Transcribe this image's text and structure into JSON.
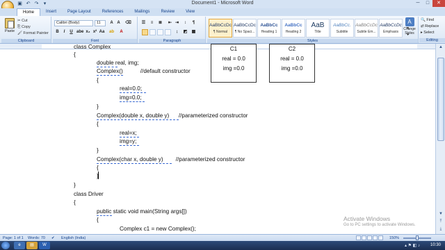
{
  "window": {
    "title": "Document1 - Microsoft Word"
  },
  "colors": {
    "accent": "#15428b",
    "ribbon_bg": "#dbe7f5",
    "close": "#c9463d",
    "squiggle": "#3a6ad3"
  },
  "tabs": [
    "Home",
    "Insert",
    "Page Layout",
    "References",
    "Mailings",
    "Review",
    "View"
  ],
  "clipboard": {
    "paste": "Paste",
    "cut": "Cut",
    "copy": "Copy",
    "format_painter": "Format Painter",
    "label": "Clipboard"
  },
  "font": {
    "name": "Calibri (Body)",
    "size": "11",
    "label": "Font"
  },
  "paragraph": {
    "label": "Paragraph"
  },
  "styles": {
    "label": "Styles",
    "items": [
      {
        "sample": "AaBbCcDc",
        "name": "¶ Normal"
      },
      {
        "sample": "AaBbCcDc",
        "name": "¶ No Spaci..."
      },
      {
        "sample": "AaBbCc",
        "name": "Heading 1"
      },
      {
        "sample": "AaBbCc",
        "name": "Heading 2"
      },
      {
        "sample": "AaB",
        "name": "Title"
      },
      {
        "sample": "AaBbCc.",
        "name": "Subtitle"
      },
      {
        "sample": "AaBbCcDc",
        "name": "Subtle Em..."
      },
      {
        "sample": "AaBbCcDc",
        "name": "Emphasis"
      }
    ],
    "change_styles": "Change Styles"
  },
  "editing": {
    "find": "Find",
    "replace": "Replace",
    "select": "Select",
    "label": "Editing"
  },
  "document": {
    "lines": [
      {
        "text": "class Complex",
        "indent": 0
      },
      {
        "text": "{",
        "indent": 0
      },
      {
        "text": "double real, img;",
        "indent": 1
      },
      {
        "text": "Complex()           //default constructor",
        "indent": 1
      },
      {
        "text": "{",
        "indent": 1
      },
      {
        "text": "real=0.0;",
        "indent": 2
      },
      {
        "text": "img=0.0;",
        "indent": 2
      },
      {
        "text": "}",
        "indent": 1
      },
      {
        "text": "Complex(double x, double y)      //parameterized constructor",
        "indent": 1
      },
      {
        "text": "{",
        "indent": 1
      },
      {
        "text": "real=x;",
        "indent": 2
      },
      {
        "text": "img=y;",
        "indent": 2
      },
      {
        "text": "}",
        "indent": 1
      },
      {
        "text": "Complex(char x, double y)        //parameterized constructor",
        "indent": 1
      },
      {
        "text": "{",
        "indent": 1
      },
      {
        "text": "}",
        "indent": 1
      },
      {
        "text": "}",
        "indent": 0
      },
      {
        "text": "class Driver",
        "indent": 0
      },
      {
        "text": "{",
        "indent": 0
      },
      {
        "text": "public static void main(String args[])",
        "indent": 1
      },
      {
        "text": "{",
        "indent": 1
      },
      {
        "text": "Complex c1 = new Complex();",
        "indent": 2
      }
    ],
    "boxes": [
      {
        "title": "C1",
        "real": "real = 0.0",
        "img": "img =0.0"
      },
      {
        "title": "C2",
        "real": "real = 0.0",
        "img": "img =0.0"
      }
    ]
  },
  "watermark": {
    "title": "Activate Windows",
    "sub": "Go to PC settings to activate Windows."
  },
  "status": {
    "page": "Page: 1 of 1",
    "words": "Words: 70",
    "language": "English (India)",
    "zoom": "150%"
  },
  "taskbar": {
    "clock": "10:30"
  }
}
